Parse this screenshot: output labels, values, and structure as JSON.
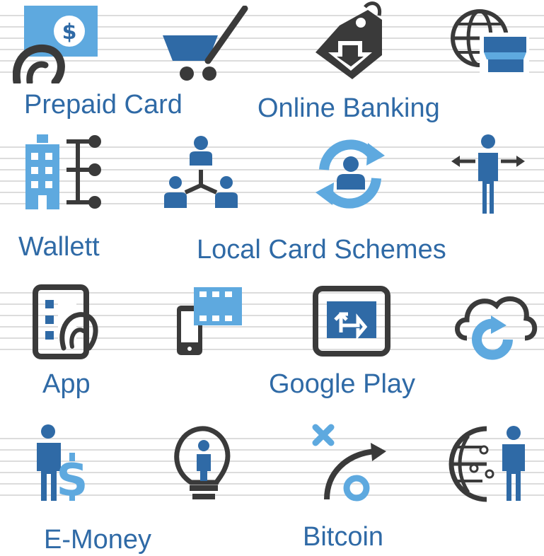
{
  "colors": {
    "blue": "#2f6aa6",
    "light_blue": "#5ea9df",
    "dark_gray": "#3a3a3a",
    "line_gray": "#dcdcdc",
    "label": "#2f6aa6"
  },
  "labels": {
    "prepaid_card": "Prepaid Card",
    "online_banking": "Online Banking",
    "wallett": "Wallett",
    "local_card_schemes": "Local Card Schemes",
    "app": "App",
    "google_play": "Google  Play",
    "e_money": "E-Money",
    "bitcoin": "Bitcoin"
  },
  "icons": [
    "card-hand-dollar-icon",
    "shopping-cart-icon",
    "price-tag-download-icon",
    "globe-shop-icon",
    "building-network-icon",
    "people-hierarchy-icon",
    "person-refresh-icon",
    "person-arrows-icon",
    "tablet-touch-icon",
    "phone-film-icon",
    "monitor-arrow-icon",
    "cloud-refresh-icon",
    "person-dollar-icon",
    "lightbulb-person-icon",
    "x-to-circle-arrow-icon",
    "globe-person-icon"
  ]
}
